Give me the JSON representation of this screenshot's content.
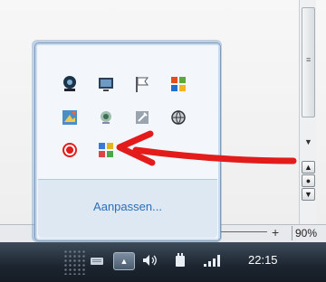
{
  "flyout": {
    "customize_label": "Aanpassen...",
    "icons": [
      "webcam-icon",
      "monitor-icon",
      "action-center-flag-icon",
      "windows-logo-icon",
      "paint-icon",
      "webcam-small-icon",
      "tool-icon",
      "network-icon",
      "opera-red-icon",
      "color-grid-icon"
    ]
  },
  "statusbar": {
    "plus_label": "+",
    "zoom_label": "90%"
  },
  "taskbar": {
    "clock": "22:15",
    "show_hidden_label": "▲"
  },
  "accent": {
    "red": "#e31b1b",
    "link": "#2a6fb8"
  }
}
